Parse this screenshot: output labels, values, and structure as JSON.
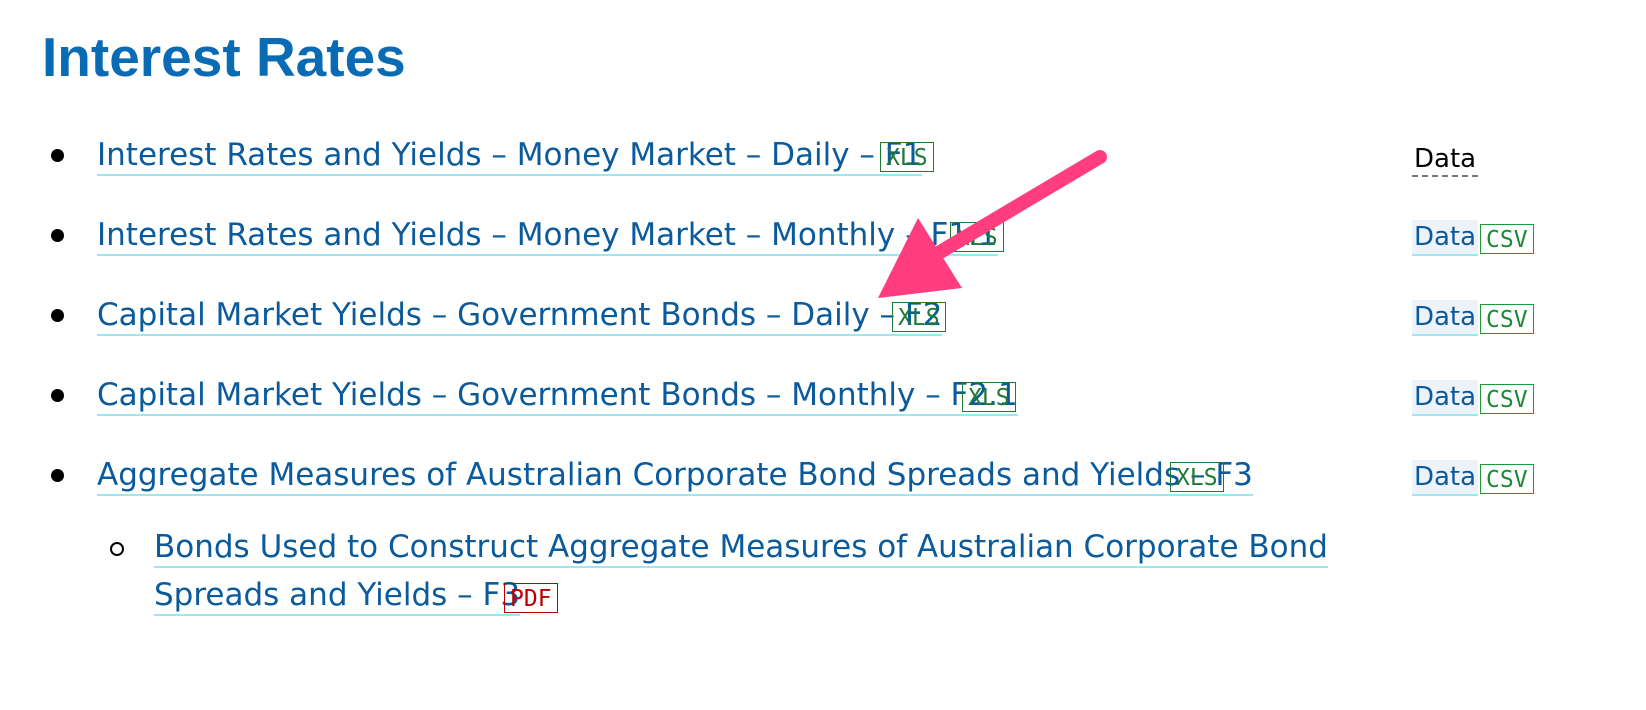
{
  "page": {
    "title": "Interest Rates"
  },
  "table_header": {
    "data_label": "Data"
  },
  "items": [
    {
      "label": "Interest Rates and Yields – Money Market – Daily – F1",
      "format": "XLS",
      "data_label": "",
      "csv_label": ""
    },
    {
      "label": "Interest Rates and Yields – Money Market – Monthly – F1.1",
      "format": "XLS",
      "data_label": "Data",
      "csv_label": "CSV"
    },
    {
      "label": "Capital Market Yields – Government Bonds – Daily – F2",
      "format": "XLS",
      "data_label": "Data",
      "csv_label": "CSV"
    },
    {
      "label": "Capital Market Yields – Government Bonds – Monthly – F2.1",
      "format": "XLS",
      "data_label": "Data",
      "csv_label": "CSV"
    },
    {
      "label": "Aggregate Measures of Australian Corporate Bond Spreads and Yields – F3",
      "format": "XLS",
      "data_label": "Data",
      "csv_label": "CSV"
    }
  ],
  "subitem": {
    "line1": "Bonds Used to Construct Aggregate Measures of Australian Corporate Bond",
    "line2": "Spreads and Yields – F3",
    "format": "PDF"
  },
  "colors": {
    "title": "#0a6bb5",
    "link": "#0a5a9c",
    "xls": "#1e7a34",
    "pdf": "#b80000",
    "annotation_arrow": "#ff3d7f"
  },
  "annotation": {
    "type": "arrow",
    "icon": "arrow-annotation-icon"
  }
}
